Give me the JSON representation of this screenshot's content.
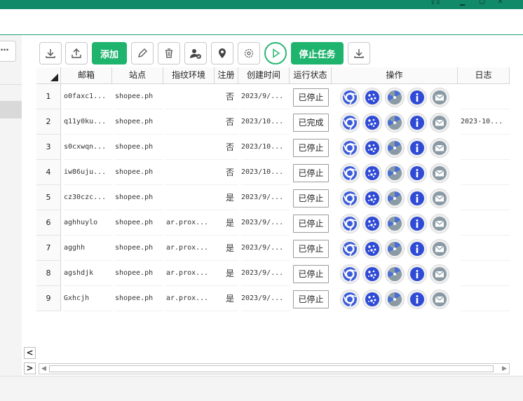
{
  "toolbar": {
    "add_label": "添加",
    "stop_label": "停止任务"
  },
  "columns": [
    "邮箱",
    "站点",
    "指纹环境",
    "注册",
    "创建时间",
    "运行状态",
    "操作",
    "日志"
  ],
  "rows": [
    {
      "n": "1",
      "email": "o0faxc1...",
      "site": "shopee.ph",
      "env": "",
      "reg": "否",
      "created": "2023/9/...",
      "status": "已停止",
      "log": ""
    },
    {
      "n": "2",
      "email": "q11y0ku...",
      "site": "shopee.ph",
      "env": "",
      "reg": "否",
      "created": "2023/10...",
      "status": "已完成",
      "log": "2023-10..."
    },
    {
      "n": "3",
      "email": "s0cxwqn...",
      "site": "shopee.ph",
      "env": "",
      "reg": "否",
      "created": "2023/10...",
      "status": "已停止",
      "log": ""
    },
    {
      "n": "4",
      "email": "iw86uju...",
      "site": "shopee.ph",
      "env": "",
      "reg": "否",
      "created": "2023/10...",
      "status": "已停止",
      "log": ""
    },
    {
      "n": "5",
      "email": "cz30czc...",
      "site": "shopee.ph",
      "env": "",
      "reg": "是",
      "created": "2023/9/...",
      "status": "已停止",
      "log": ""
    },
    {
      "n": "6",
      "email": "aghhuylo",
      "site": "shopee.ph",
      "env": "ar.prox...",
      "reg": "是",
      "created": "2023/9/...",
      "status": "已停止",
      "log": ""
    },
    {
      "n": "7",
      "email": "agghh",
      "site": "shopee.ph",
      "env": "ar.prox...",
      "reg": "是",
      "created": "2023/9/...",
      "status": "已停止",
      "log": ""
    },
    {
      "n": "8",
      "email": "agshdjk",
      "site": "shopee.ph",
      "env": "ar.prox...",
      "reg": "是",
      "created": "2023/9/...",
      "status": "已停止",
      "log": ""
    },
    {
      "n": "9",
      "email": "Gxhcjh",
      "site": "shopee.ph",
      "env": "ar.prox...",
      "reg": "是",
      "created": "2023/9/...",
      "status": "已停止",
      "log": ""
    }
  ],
  "colors": {
    "accent": "#1fb46e",
    "titlebar": "#118a69",
    "chrome_blue": "#3b5bdb",
    "gray_icon": "#8a9aa5"
  },
  "icons": {
    "row_ops": [
      "chrome-icon",
      "cookie-icon",
      "fan-icon",
      "info-icon",
      "mail-icon"
    ]
  }
}
